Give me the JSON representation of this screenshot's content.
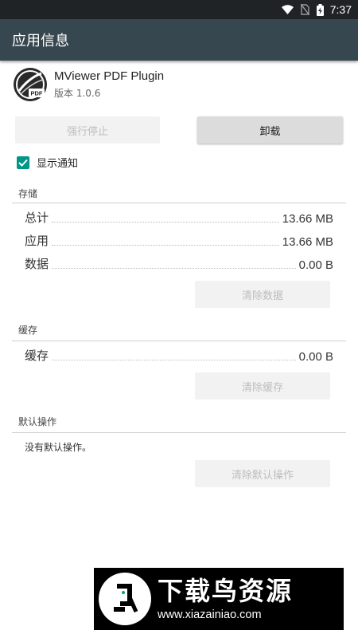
{
  "status_bar": {
    "time": "7:37",
    "icons": [
      "wifi-icon",
      "no-sim-icon",
      "battery-charging-icon"
    ]
  },
  "app_bar": {
    "title": "应用信息"
  },
  "app": {
    "name": "MViewer PDF Plugin",
    "version": "版本 1.0.6",
    "icon_badge": "PDF"
  },
  "actions": {
    "force_stop": "强行停止",
    "uninstall": "卸载"
  },
  "notifications": {
    "label": "显示通知",
    "checked": true,
    "accent": "#009688"
  },
  "storage": {
    "title": "存储",
    "rows": [
      {
        "label": "总计",
        "value": "13.66 MB"
      },
      {
        "label": "应用",
        "value": "13.66 MB"
      },
      {
        "label": "数据",
        "value": "0.00 B"
      }
    ],
    "clear_button": "清除数据"
  },
  "cache": {
    "title": "缓存",
    "rows": [
      {
        "label": "缓存",
        "value": "0.00 B"
      }
    ],
    "clear_button": "清除缓存"
  },
  "defaults": {
    "title": "默认操作",
    "text": "没有默认操作。",
    "clear_button": "清除默认操作"
  },
  "watermark": {
    "title": "下载鸟资源",
    "url": "www.xiazainiao.com"
  },
  "colors": {
    "status_bar": "#202325",
    "app_bar": "#37474f",
    "checkbox": "#009688"
  }
}
